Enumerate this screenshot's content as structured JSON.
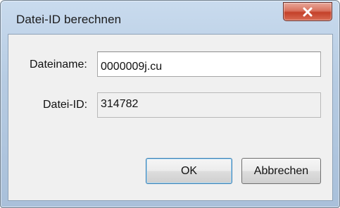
{
  "window": {
    "title": "Datei-ID berechnen",
    "close_icon": "close-icon"
  },
  "form": {
    "filename_label": "Dateiname:",
    "filename_value": "0000009j.cu",
    "fileid_label": "Datei-ID:",
    "fileid_value": "314782"
  },
  "buttons": {
    "ok_label": "OK",
    "cancel_label": "Abbrechen"
  },
  "colors": {
    "close_button": "#c4412a",
    "default_button_border": "#3c7fb1",
    "title_bar": "#b6cbe2"
  }
}
